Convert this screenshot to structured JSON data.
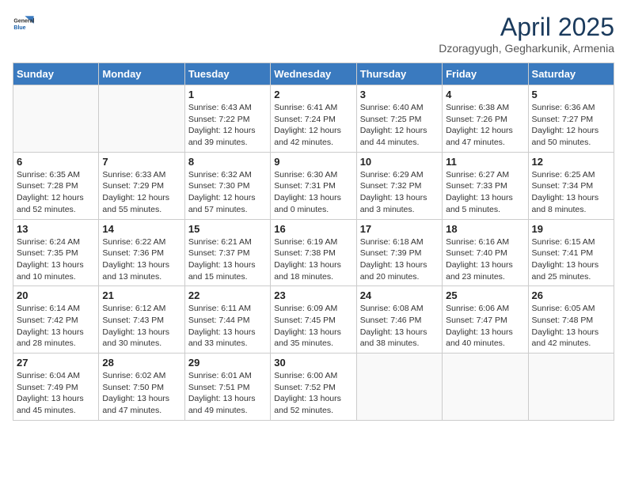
{
  "header": {
    "logo_general": "General",
    "logo_blue": "Blue",
    "title": "April 2025",
    "subtitle": "Dzoragyugh, Gegharkunik, Armenia"
  },
  "days_of_week": [
    "Sunday",
    "Monday",
    "Tuesday",
    "Wednesday",
    "Thursday",
    "Friday",
    "Saturday"
  ],
  "weeks": [
    [
      {
        "day": "",
        "sunrise": "",
        "sunset": "",
        "daylight": ""
      },
      {
        "day": "",
        "sunrise": "",
        "sunset": "",
        "daylight": ""
      },
      {
        "day": "1",
        "sunrise": "Sunrise: 6:43 AM",
        "sunset": "Sunset: 7:22 PM",
        "daylight": "Daylight: 12 hours and 39 minutes."
      },
      {
        "day": "2",
        "sunrise": "Sunrise: 6:41 AM",
        "sunset": "Sunset: 7:24 PM",
        "daylight": "Daylight: 12 hours and 42 minutes."
      },
      {
        "day": "3",
        "sunrise": "Sunrise: 6:40 AM",
        "sunset": "Sunset: 7:25 PM",
        "daylight": "Daylight: 12 hours and 44 minutes."
      },
      {
        "day": "4",
        "sunrise": "Sunrise: 6:38 AM",
        "sunset": "Sunset: 7:26 PM",
        "daylight": "Daylight: 12 hours and 47 minutes."
      },
      {
        "day": "5",
        "sunrise": "Sunrise: 6:36 AM",
        "sunset": "Sunset: 7:27 PM",
        "daylight": "Daylight: 12 hours and 50 minutes."
      }
    ],
    [
      {
        "day": "6",
        "sunrise": "Sunrise: 6:35 AM",
        "sunset": "Sunset: 7:28 PM",
        "daylight": "Daylight: 12 hours and 52 minutes."
      },
      {
        "day": "7",
        "sunrise": "Sunrise: 6:33 AM",
        "sunset": "Sunset: 7:29 PM",
        "daylight": "Daylight: 12 hours and 55 minutes."
      },
      {
        "day": "8",
        "sunrise": "Sunrise: 6:32 AM",
        "sunset": "Sunset: 7:30 PM",
        "daylight": "Daylight: 12 hours and 57 minutes."
      },
      {
        "day": "9",
        "sunrise": "Sunrise: 6:30 AM",
        "sunset": "Sunset: 7:31 PM",
        "daylight": "Daylight: 13 hours and 0 minutes."
      },
      {
        "day": "10",
        "sunrise": "Sunrise: 6:29 AM",
        "sunset": "Sunset: 7:32 PM",
        "daylight": "Daylight: 13 hours and 3 minutes."
      },
      {
        "day": "11",
        "sunrise": "Sunrise: 6:27 AM",
        "sunset": "Sunset: 7:33 PM",
        "daylight": "Daylight: 13 hours and 5 minutes."
      },
      {
        "day": "12",
        "sunrise": "Sunrise: 6:25 AM",
        "sunset": "Sunset: 7:34 PM",
        "daylight": "Daylight: 13 hours and 8 minutes."
      }
    ],
    [
      {
        "day": "13",
        "sunrise": "Sunrise: 6:24 AM",
        "sunset": "Sunset: 7:35 PM",
        "daylight": "Daylight: 13 hours and 10 minutes."
      },
      {
        "day": "14",
        "sunrise": "Sunrise: 6:22 AM",
        "sunset": "Sunset: 7:36 PM",
        "daylight": "Daylight: 13 hours and 13 minutes."
      },
      {
        "day": "15",
        "sunrise": "Sunrise: 6:21 AM",
        "sunset": "Sunset: 7:37 PM",
        "daylight": "Daylight: 13 hours and 15 minutes."
      },
      {
        "day": "16",
        "sunrise": "Sunrise: 6:19 AM",
        "sunset": "Sunset: 7:38 PM",
        "daylight": "Daylight: 13 hours and 18 minutes."
      },
      {
        "day": "17",
        "sunrise": "Sunrise: 6:18 AM",
        "sunset": "Sunset: 7:39 PM",
        "daylight": "Daylight: 13 hours and 20 minutes."
      },
      {
        "day": "18",
        "sunrise": "Sunrise: 6:16 AM",
        "sunset": "Sunset: 7:40 PM",
        "daylight": "Daylight: 13 hours and 23 minutes."
      },
      {
        "day": "19",
        "sunrise": "Sunrise: 6:15 AM",
        "sunset": "Sunset: 7:41 PM",
        "daylight": "Daylight: 13 hours and 25 minutes."
      }
    ],
    [
      {
        "day": "20",
        "sunrise": "Sunrise: 6:14 AM",
        "sunset": "Sunset: 7:42 PM",
        "daylight": "Daylight: 13 hours and 28 minutes."
      },
      {
        "day": "21",
        "sunrise": "Sunrise: 6:12 AM",
        "sunset": "Sunset: 7:43 PM",
        "daylight": "Daylight: 13 hours and 30 minutes."
      },
      {
        "day": "22",
        "sunrise": "Sunrise: 6:11 AM",
        "sunset": "Sunset: 7:44 PM",
        "daylight": "Daylight: 13 hours and 33 minutes."
      },
      {
        "day": "23",
        "sunrise": "Sunrise: 6:09 AM",
        "sunset": "Sunset: 7:45 PM",
        "daylight": "Daylight: 13 hours and 35 minutes."
      },
      {
        "day": "24",
        "sunrise": "Sunrise: 6:08 AM",
        "sunset": "Sunset: 7:46 PM",
        "daylight": "Daylight: 13 hours and 38 minutes."
      },
      {
        "day": "25",
        "sunrise": "Sunrise: 6:06 AM",
        "sunset": "Sunset: 7:47 PM",
        "daylight": "Daylight: 13 hours and 40 minutes."
      },
      {
        "day": "26",
        "sunrise": "Sunrise: 6:05 AM",
        "sunset": "Sunset: 7:48 PM",
        "daylight": "Daylight: 13 hours and 42 minutes."
      }
    ],
    [
      {
        "day": "27",
        "sunrise": "Sunrise: 6:04 AM",
        "sunset": "Sunset: 7:49 PM",
        "daylight": "Daylight: 13 hours and 45 minutes."
      },
      {
        "day": "28",
        "sunrise": "Sunrise: 6:02 AM",
        "sunset": "Sunset: 7:50 PM",
        "daylight": "Daylight: 13 hours and 47 minutes."
      },
      {
        "day": "29",
        "sunrise": "Sunrise: 6:01 AM",
        "sunset": "Sunset: 7:51 PM",
        "daylight": "Daylight: 13 hours and 49 minutes."
      },
      {
        "day": "30",
        "sunrise": "Sunrise: 6:00 AM",
        "sunset": "Sunset: 7:52 PM",
        "daylight": "Daylight: 13 hours and 52 minutes."
      },
      {
        "day": "",
        "sunrise": "",
        "sunset": "",
        "daylight": ""
      },
      {
        "day": "",
        "sunrise": "",
        "sunset": "",
        "daylight": ""
      },
      {
        "day": "",
        "sunrise": "",
        "sunset": "",
        "daylight": ""
      }
    ]
  ]
}
